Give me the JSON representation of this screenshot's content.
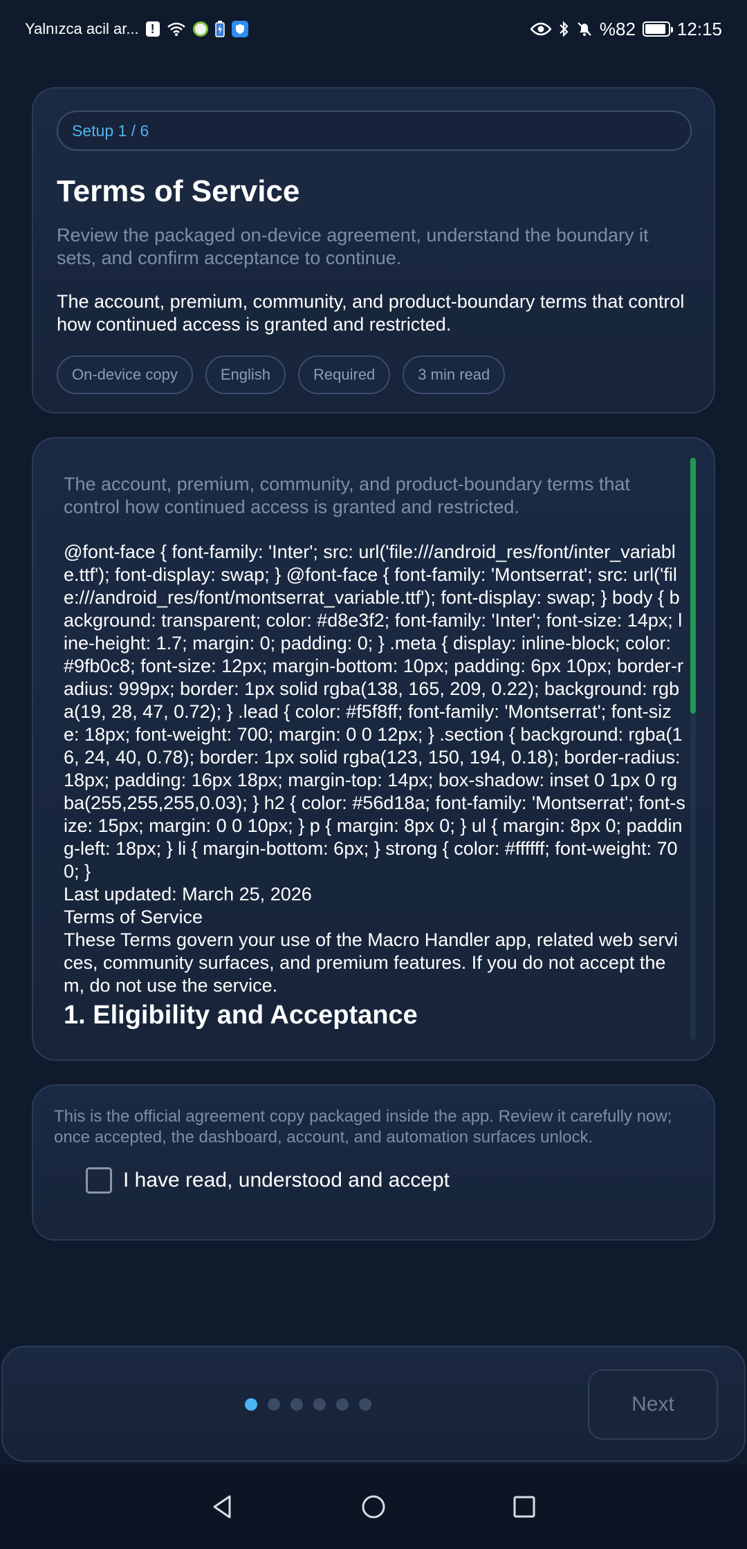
{
  "status_bar": {
    "carrier": "Yalnızca acil ar...",
    "battery_percent": "%82",
    "battery_level": 0.82,
    "time": "12:15"
  },
  "header_card": {
    "step": "Setup 1 / 6",
    "title": "Terms of Service",
    "subtitle": "Review the packaged on-device agreement, understand the boundary it sets, and confirm acceptance to continue.",
    "lead": "The account, premium, community, and product-boundary terms that control how continued access is granted and restricted.",
    "chips": [
      "On-device copy",
      "English",
      "Required",
      "3 min read"
    ]
  },
  "terms": {
    "intro": "The account, premium, community, and product-boundary terms that control how continued access is granted and restricted.",
    "css_dump": "@font-face { font-family: 'Inter'; src: url('file:///android_res/font/inter_variable.ttf'); font-display: swap; } @font-face { font-family: 'Montserrat'; src: url('file:///android_res/font/montserrat_variable.ttf'); font-display: swap; } body { background: transparent; color: #d8e3f2; font-family: 'Inter'; font-size: 14px; line-height: 1.7; margin: 0; padding: 0; } .meta { display: inline-block; color: #9fb0c8; font-size: 12px; margin-bottom: 10px; padding: 6px 10px; border-radius: 999px; border: 1px solid rgba(138, 165, 209, 0.22); background: rgba(19, 28, 47, 0.72); } .lead { color: #f5f8ff; font-family: 'Montserrat'; font-size: 18px; font-weight: 700; margin: 0 0 12px; } .section { background: rgba(16, 24, 40, 0.78); border: 1px solid rgba(123, 150, 194, 0.18); border-radius: 18px; padding: 16px 18px; margin-top: 14px; box-shadow: inset 0 1px 0 rgba(255,255,255,0.03); } h2 { color: #56d18a; font-family: 'Montserrat'; font-size: 15px; margin: 0 0 10px; } p { margin: 8px 0; } ul { margin: 8px 0; padding-left: 18px; } li { margin-bottom: 6px; } strong { color: #ffffff; font-weight: 700; }",
    "last_updated": "Last updated: March 25, 2026",
    "doc_title": "Terms of Service",
    "paragraph": "These Terms govern your use of the Macro Handler app, related web services, community surfaces, and premium features. If you do not accept them, do not use the service.",
    "section_heading": "1. Eligibility and Acceptance",
    "scroll_progress": 0.44
  },
  "accept_card": {
    "note": "This is the official agreement copy packaged inside the app. Review it carefully now; once accepted, the dashboard, account, and automation surfaces unlock.",
    "checkbox_label": "I have read, understood and accept",
    "checked": false
  },
  "footer": {
    "total_steps": 6,
    "current_step": 1,
    "next_label": "Next"
  },
  "colors": {
    "accent": "#48b6f2",
    "scroll_thumb": "#1f9a52",
    "background": "#0f1a2c"
  }
}
